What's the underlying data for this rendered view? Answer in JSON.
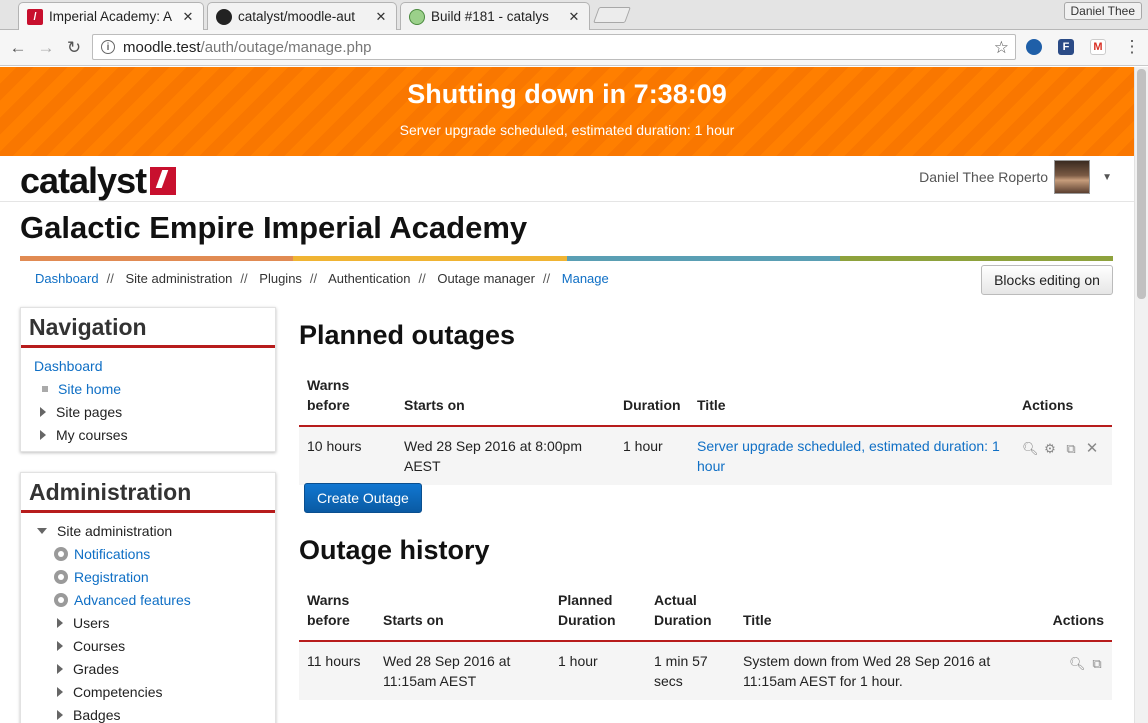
{
  "browser": {
    "tabs": [
      {
        "title": "Imperial Academy: A",
        "favicon": "moodle-icon"
      },
      {
        "title": "catalyst/moodle-aut",
        "favicon": "github-icon"
      },
      {
        "title": "Build #181 - catalys",
        "favicon": "jenkins-icon"
      }
    ],
    "profile": "Daniel Thee",
    "url_host": "moodle.test",
    "url_path": "/auth/outage/manage.php"
  },
  "banner": {
    "title": "Shutting down in 7:38:09",
    "subtitle": "Server upgrade scheduled, estimated duration: 1 hour",
    "color": "#ff7f00"
  },
  "header": {
    "logo_text": "catalyst",
    "user_name": "Daniel Thee Roperto"
  },
  "site_title": "Galactic Empire Imperial Academy",
  "colorbar": [
    "#e18b53",
    "#f0b433",
    "#5a9fb4",
    "#8ea23d"
  ],
  "breadcrumb": [
    "Dashboard",
    "Site administration",
    "Plugins",
    "Authentication",
    "Outage manager",
    "Manage"
  ],
  "breadcrumb_sep": "//",
  "blocks_button": "Blocks editing on",
  "navigation": {
    "title": "Navigation",
    "dashboard": "Dashboard",
    "site_home": "Site home",
    "site_pages": "Site pages",
    "my_courses": "My courses"
  },
  "administration": {
    "title": "Administration",
    "site_admin": "Site administration",
    "notifications": "Notifications",
    "registration": "Registration",
    "advanced_features": "Advanced features",
    "users": "Users",
    "courses": "Courses",
    "grades": "Grades",
    "competencies": "Competencies",
    "badges": "Badges"
  },
  "planned": {
    "heading": "Planned outages",
    "columns": {
      "warns1": "Warns",
      "warns2": "before",
      "starts": "Starts on",
      "duration": "Duration",
      "title": "Title",
      "actions": "Actions"
    },
    "row": {
      "warns": "10 hours",
      "starts": "Wed 28 Sep 2016 at 8:00pm AEST",
      "duration": "1 hour",
      "title": "Server upgrade scheduled, estimated duration: 1 hour"
    },
    "create_button": "Create Outage"
  },
  "history": {
    "heading": "Outage history",
    "columns": {
      "warns1": "Warns",
      "warns2": "before",
      "starts": "Starts on",
      "planned1": "Planned",
      "planned2": "Duration",
      "actual1": "Actual",
      "actual2": "Duration",
      "title": "Title",
      "actions": "Actions"
    },
    "row": {
      "warns": "11 hours",
      "starts": "Wed 28 Sep 2016 at 11:15am AEST",
      "planned": "1 hour",
      "actual": "1 min 57 secs",
      "title": "System down from Wed 28 Sep 2016 at 11:15am AEST for 1 hour."
    }
  }
}
